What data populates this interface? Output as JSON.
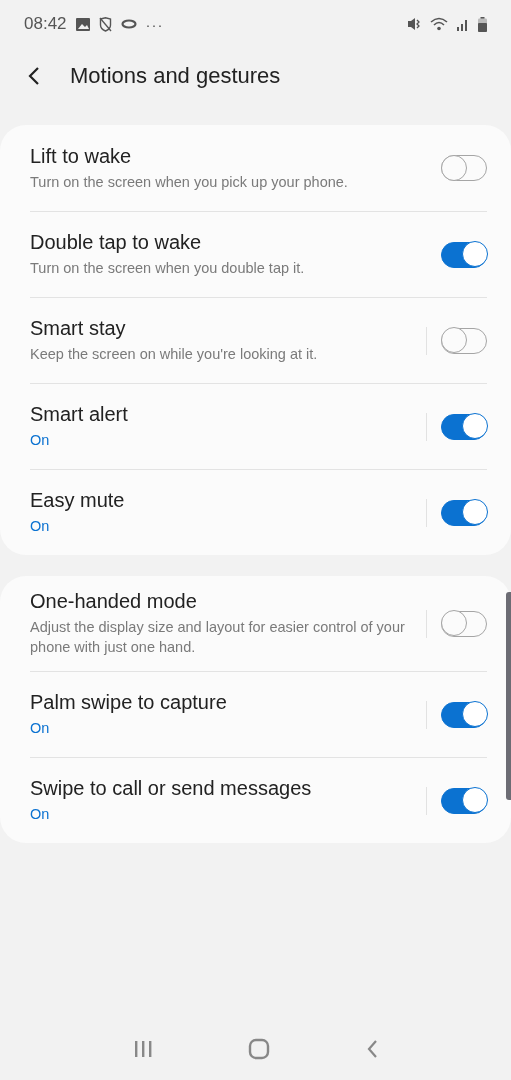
{
  "status_bar": {
    "time": "08:42",
    "more": "···"
  },
  "header": {
    "title": "Motions and gestures"
  },
  "groups": [
    {
      "items": [
        {
          "title": "Lift to wake",
          "kind": "description",
          "subtitle": "Turn on the screen when you pick up your phone.",
          "split": false,
          "on": false
        },
        {
          "title": "Double tap to wake",
          "kind": "description",
          "subtitle": "Turn on the screen when you double tap it.",
          "split": false,
          "on": true
        },
        {
          "title": "Smart stay",
          "kind": "description",
          "subtitle": "Keep the screen on while you're looking at it.",
          "split": true,
          "on": false
        },
        {
          "title": "Smart alert",
          "kind": "status",
          "subtitle": "On",
          "split": true,
          "on": true
        },
        {
          "title": "Easy mute",
          "kind": "status",
          "subtitle": "On",
          "split": true,
          "on": true
        }
      ]
    },
    {
      "items": [
        {
          "title": "One-handed mode",
          "kind": "description",
          "subtitle": "Adjust the display size and layout for easier control of your phone with just one hand.",
          "split": true,
          "on": false
        },
        {
          "title": "Palm swipe to capture",
          "kind": "status",
          "subtitle": "On",
          "split": true,
          "on": true
        },
        {
          "title": "Swipe to call or send messages",
          "kind": "status",
          "subtitle": "On",
          "split": true,
          "on": true
        }
      ]
    }
  ]
}
